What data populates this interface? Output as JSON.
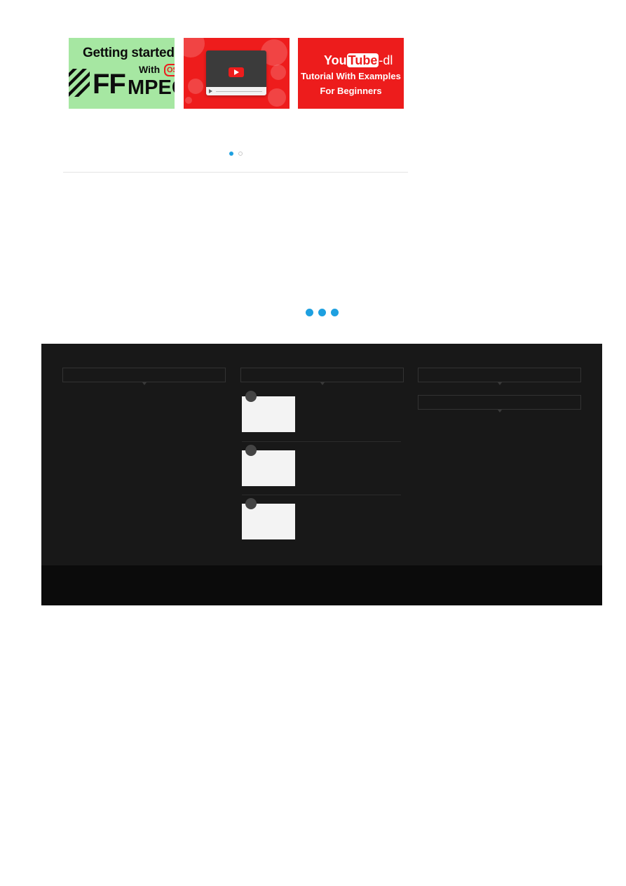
{
  "carousel": {
    "slides": [
      {
        "headline": "Getting started",
        "with": "With",
        "badge": "OS",
        "ff": "FF",
        "mpeg": "MPEG"
      },
      {
        "label": ""
      },
      {
        "logo_you": "You",
        "logo_tube": "Tube",
        "logo_dl": "-dl",
        "line1": "Tutorial With Examples",
        "line2": "For Beginners"
      }
    ],
    "pagination": {
      "current": 1,
      "total": 2
    }
  },
  "loader": {
    "dots": 3,
    "color": "#1ea0e0"
  },
  "footer": {
    "background": "#181818",
    "bottom_background": "#0b0b0b",
    "popular_posts": [
      {
        "rank": ""
      },
      {
        "rank": ""
      },
      {
        "rank": ""
      }
    ]
  },
  "colors": {
    "accent": "#1ea0e0",
    "ffmpeg_green": "#a6e7a2",
    "youtube_red": "#ee1c1c"
  }
}
